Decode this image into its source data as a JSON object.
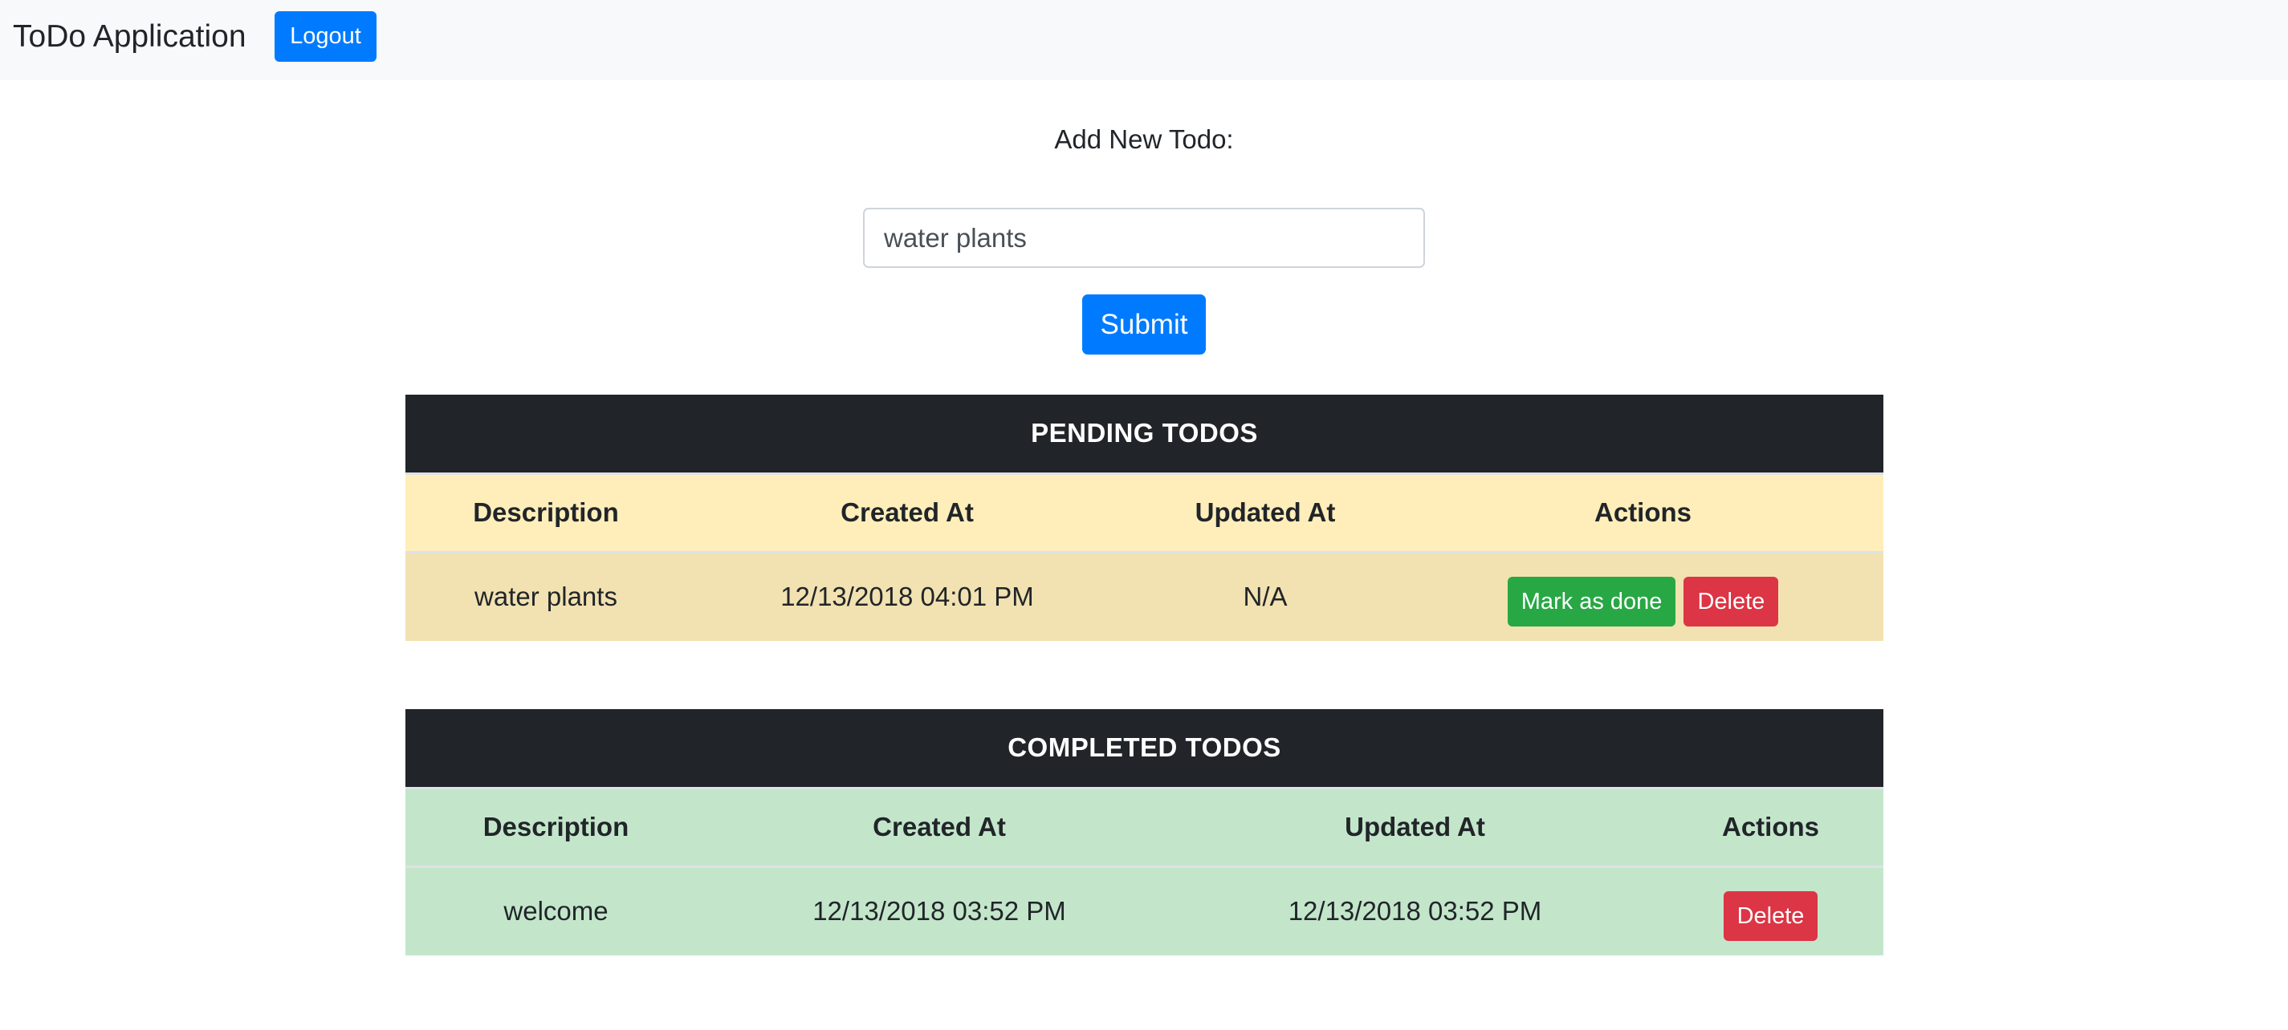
{
  "navbar": {
    "brand": "ToDo Application",
    "logout_label": "Logout"
  },
  "form": {
    "label": "Add New Todo:",
    "input_value": "water plants",
    "submit_label": "Submit"
  },
  "pending": {
    "title": "PENDING TODOS",
    "columns": [
      "Description",
      "Created At",
      "Updated At",
      "Actions"
    ],
    "rows": [
      {
        "description": "water plants",
        "created_at": "12/13/2018 04:01 PM",
        "updated_at": "N/A",
        "mark_done_label": "Mark as done",
        "delete_label": "Delete"
      }
    ]
  },
  "completed": {
    "title": "COMPLETED TODOS",
    "columns": [
      "Description",
      "Created At",
      "Updated At",
      "Actions"
    ],
    "rows": [
      {
        "description": "welcome",
        "created_at": "12/13/2018 03:52 PM",
        "updated_at": "12/13/2018 03:52 PM",
        "delete_label": "Delete"
      }
    ]
  },
  "colors": {
    "primary": "#007bff",
    "success": "#28a745",
    "danger": "#dc3545",
    "dark": "#212529",
    "warning_light": "#ffeeba",
    "success_light": "#c3e6cb"
  }
}
